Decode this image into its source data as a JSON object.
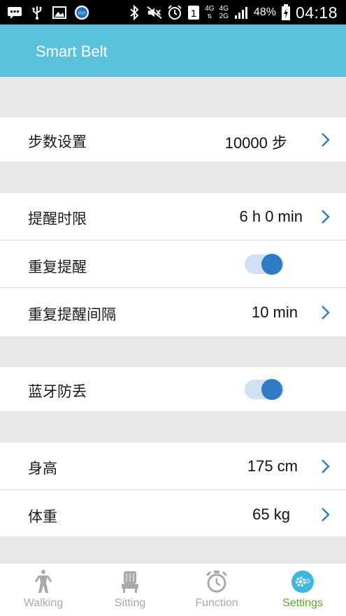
{
  "status_bar": {
    "battery_percent": "48%",
    "time": "04:18",
    "sim_number": "1",
    "network_top": "4G",
    "network_second_top": "4G",
    "network_second_bottom": "2G",
    "icons": [
      "message-icon",
      "usb-icon",
      "image-icon",
      "ifly-icon",
      "bluetooth-icon",
      "mute-icon",
      "alarm-icon",
      "sim-icon",
      "signal-icon",
      "battery-icon"
    ],
    "ifly_text": "iFLY"
  },
  "app": {
    "title": "Smart Belt",
    "accent_color": "#5bc2de",
    "active_color": "#5aa52c"
  },
  "settings": {
    "steps": {
      "label": "步数设置",
      "value": "10000 步"
    },
    "reminder_limit": {
      "label": "提醒时限",
      "value": "6 h 0 min"
    },
    "repeat_reminder": {
      "label": "重复提醒",
      "enabled": true
    },
    "repeat_interval": {
      "label": "重复提醒间隔",
      "value": "10 min"
    },
    "anti_loss": {
      "label": "蓝牙防丢",
      "enabled": true
    },
    "height": {
      "label": "身高",
      "value": "175 cm"
    },
    "weight": {
      "label": "体重",
      "value": "65 kg"
    }
  },
  "nav": {
    "items": [
      {
        "label": "Walking",
        "icon": "walking-icon",
        "active": false
      },
      {
        "label": "Sitting",
        "icon": "chair-icon",
        "active": false
      },
      {
        "label": "Function",
        "icon": "alarm-clock-icon",
        "active": false
      },
      {
        "label": "Settings",
        "icon": "gear-icon",
        "active": true
      }
    ]
  }
}
